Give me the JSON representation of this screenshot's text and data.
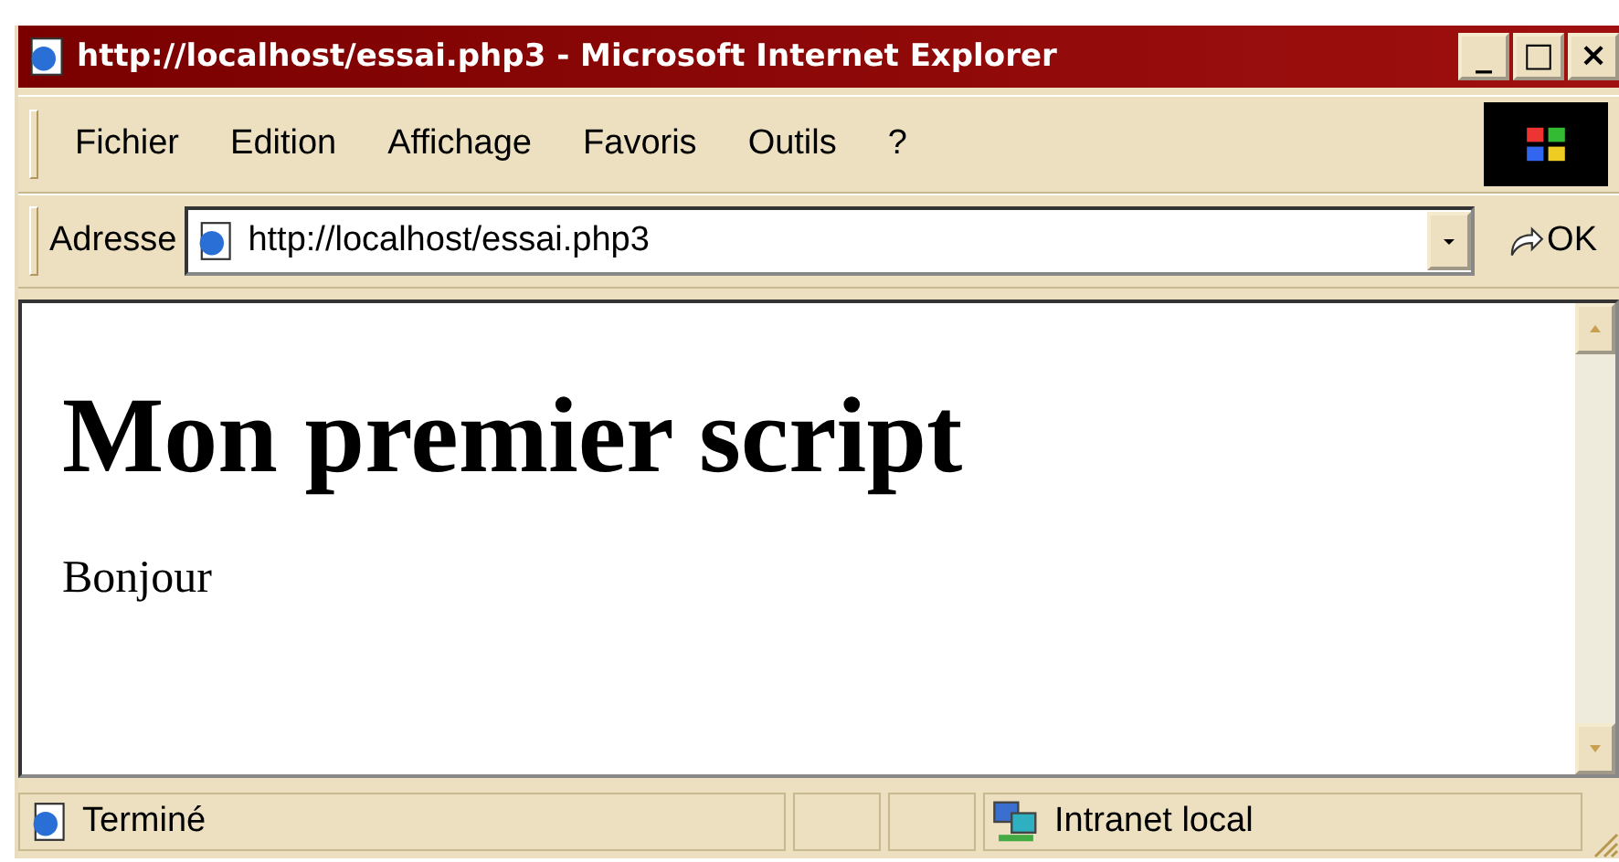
{
  "window": {
    "title": "http://localhost/essai.php3 - Microsoft Internet Explorer",
    "controls": [
      "_",
      "□",
      "×"
    ]
  },
  "menu": [
    {
      "label": "Fichier"
    },
    {
      "label": "Edition"
    },
    {
      "label": "Affichage"
    },
    {
      "label": "Favoris"
    },
    {
      "label": "Outils"
    },
    {
      "label": "?"
    }
  ],
  "address_bar": {
    "label": "Adresse",
    "value": "http://localhost/essai.php3",
    "go": "OK"
  },
  "page": {
    "heading": "Mon premier script",
    "paragraph": "Bonjour"
  },
  "status_bar": {
    "text": "Terminé",
    "zone": "Intranet local"
  }
}
